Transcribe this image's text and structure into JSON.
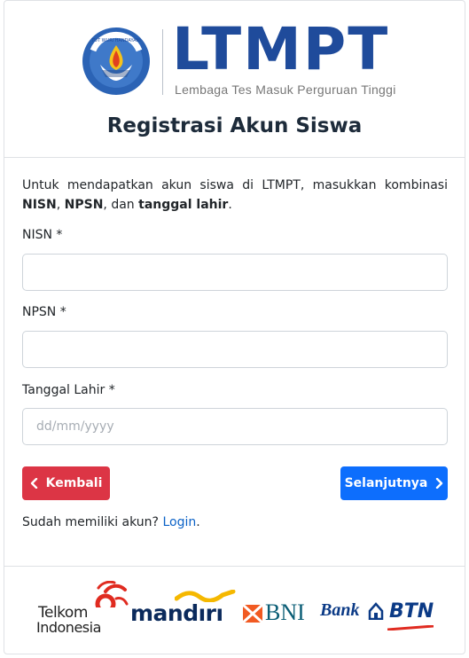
{
  "header": {
    "brand_name": "LTMPT",
    "brand_tagline": "Lembaga Tes Masuk Perguruan Tinggi",
    "emblem_text": "TUT WURI HANDAYANI",
    "page_title": "Registrasi Akun Siswa"
  },
  "intro": {
    "text_1": "Untuk mendapatkan akun siswa di LTMPT, masukkan kombinasi ",
    "bold_1": "NISN",
    "text_2": ", ",
    "bold_2": "NPSN",
    "text_3": ", dan ",
    "bold_3": "tanggal lahir",
    "text_4": "."
  },
  "form": {
    "nisn_label": "NISN *",
    "nisn_value": "",
    "npsn_label": "NPSN *",
    "npsn_value": "",
    "dob_label": "Tanggal Lahir *",
    "dob_value": "",
    "dob_placeholder": "dd/mm/yyyy"
  },
  "actions": {
    "back_label": "Kembali",
    "next_label": "Selanjutnya"
  },
  "login": {
    "prompt": "Sudah memiliki akun?",
    "link_label": "Login",
    "suffix": "."
  },
  "partners": {
    "telkom_line1": "Telkom",
    "telkom_line2": "Indonesia",
    "mandiri": "mandırı",
    "bni": "BNI",
    "btn_bank": "Bank",
    "btn_name": "BTN"
  },
  "colors": {
    "brand_blue": "#1f4b9b",
    "back_button": "#dc3545",
    "next_button": "#0d6efd",
    "link": "#0b62c7",
    "telkom_red": "#e02b20",
    "mandiri_gold": "#f5b800",
    "bni_orange": "#f15a22"
  },
  "icons": {
    "back": "chevron-left-icon",
    "next": "chevron-right-icon"
  }
}
